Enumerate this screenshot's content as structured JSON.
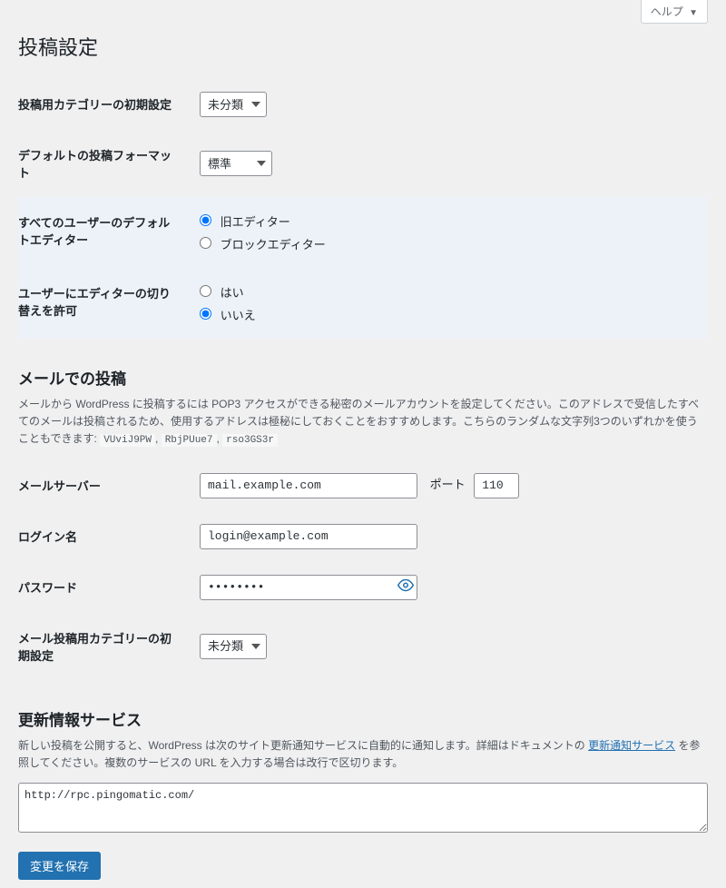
{
  "help": {
    "label": "ヘルプ"
  },
  "page_title": "投稿設定",
  "rows": {
    "default_category": {
      "label": "投稿用カテゴリーの初期設定",
      "value": "未分類"
    },
    "default_format": {
      "label": "デフォルトの投稿フォーマット",
      "value": "標準"
    },
    "default_editor": {
      "label": "すべてのユーザーのデフォルトエディター",
      "opt_classic": "旧エディター",
      "opt_block": "ブロックエディター"
    },
    "allow_switch": {
      "label": "ユーザーにエディターの切り替えを許可",
      "opt_yes": "はい",
      "opt_no": "いいえ"
    }
  },
  "mail": {
    "heading": "メールでの投稿",
    "desc_prefix": "メールから WordPress に投稿するには POP3 アクセスができる秘密のメールアカウントを設定してください。このアドレスで受信したすべてのメールは投稿されるため、使用するアドレスは極秘にしておくことをおすすめします。こちらのランダムな文字列3つのいずれかを使うこともできます: ",
    "rand1": "VUviJ9PW",
    "rand2": "RbjPUue7",
    "rand3": "rso3GS3r",
    "server_label": "メールサーバー",
    "server_value": "mail.example.com",
    "port_label": "ポート",
    "port_value": "110",
    "login_label": "ログイン名",
    "login_value": "login@example.com",
    "password_label": "パスワード",
    "password_value": "password",
    "mail_category_label": "メール投稿用カテゴリーの初期設定",
    "mail_category_value": "未分類"
  },
  "update": {
    "heading": "更新情報サービス",
    "desc_prefix": "新しい投稿を公開すると、WordPress は次のサイト更新通知サービスに自動的に通知します。詳細はドキュメントの ",
    "link_text": "更新通知サービス",
    "desc_suffix": " を参照してください。複数のサービスの URL を入力する場合は改行で区切ります。",
    "textarea_value": "http://rpc.pingomatic.com/"
  },
  "submit": {
    "label": "変更を保存"
  }
}
